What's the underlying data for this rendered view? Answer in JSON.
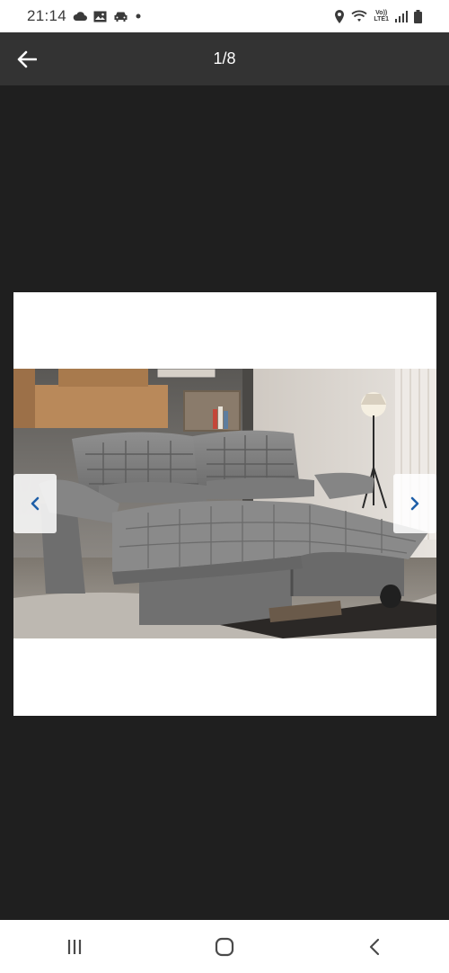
{
  "status_bar": {
    "time": "21:14",
    "volte_line1": "Vo))",
    "volte_line2": "LTE1",
    "left_icons": [
      "cloud-icon",
      "image-icon",
      "car-icon",
      "dot-icon"
    ],
    "right_icons": [
      "location-icon",
      "wifi-icon",
      "signal-icon",
      "battery-icon"
    ]
  },
  "app_bar": {
    "back_icon": "arrow-left-icon",
    "counter": "1/8"
  },
  "viewer": {
    "image_subject": "gray-sofa-photo",
    "prev_icon": "chevron-left-icon",
    "next_icon": "chevron-right-icon"
  },
  "nav_bar": {
    "icons": [
      "recent-apps-icon",
      "home-icon",
      "back-icon"
    ]
  },
  "colors": {
    "arrow_accent": "#1f5fa8",
    "app_bar": "#333333",
    "background": "#1f1f1f"
  }
}
